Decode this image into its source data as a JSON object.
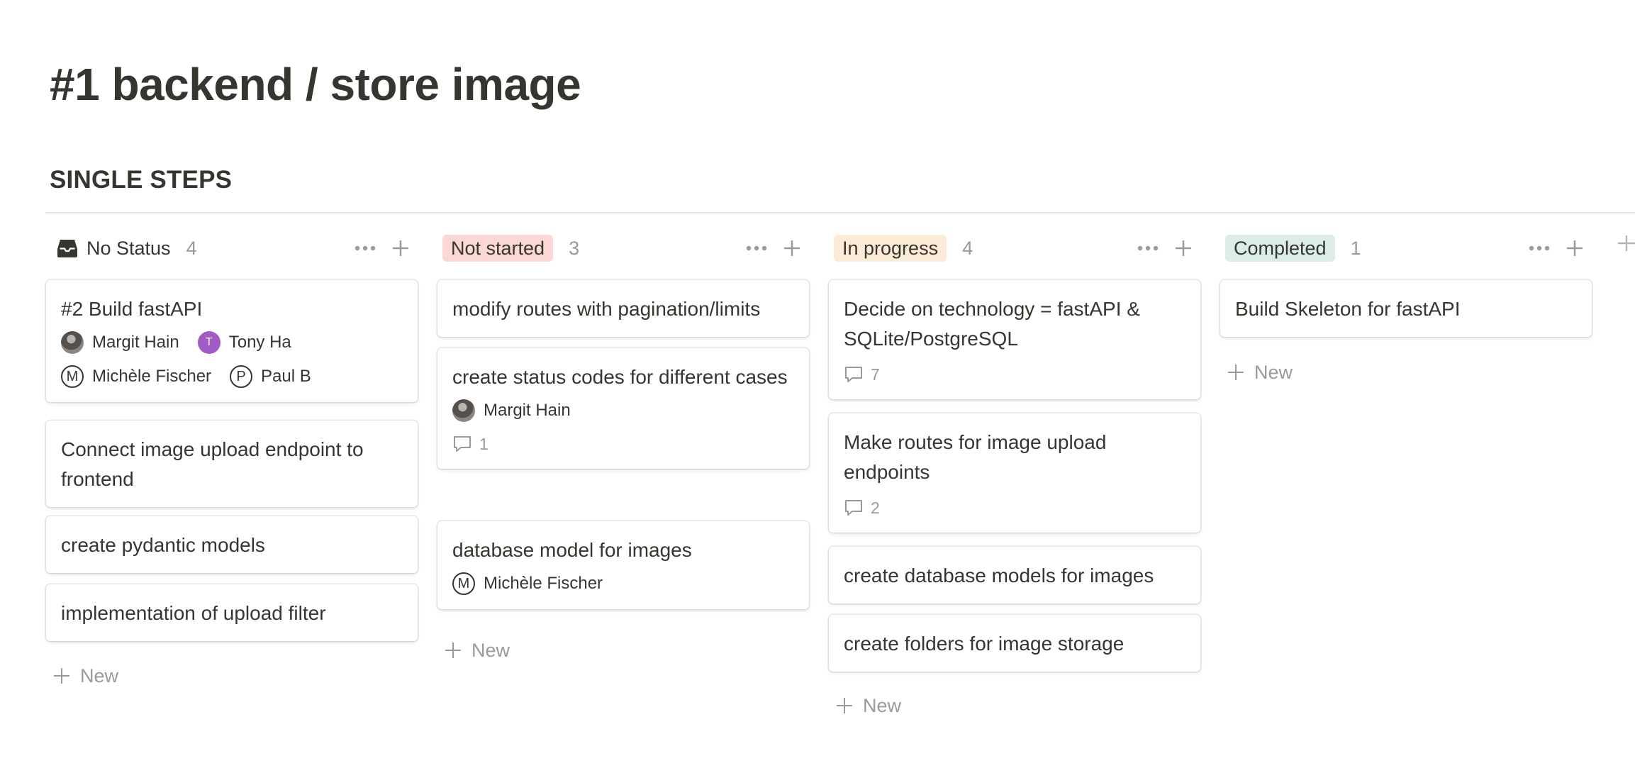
{
  "page": {
    "title": "#1 backend / store image",
    "section": "SINGLE STEPS"
  },
  "columns": [
    {
      "title": "No Status",
      "count": "4",
      "tag_color": "",
      "cards": [
        {
          "title": "#2 Build fastAPI",
          "people": [
            {
              "name": "Margit Hain",
              "avatar": "photo"
            },
            {
              "name": "Tony Ha",
              "avatar": "T"
            },
            {
              "name": "Michèle Fischer",
              "avatar": "M"
            },
            {
              "name": "Paul B",
              "avatar": "P"
            }
          ]
        },
        {
          "title": "Connect image upload endpoint to frontend"
        },
        {
          "title": "create pydantic models"
        },
        {
          "title": "implementation of upload filter"
        }
      ],
      "new_label": "New"
    },
    {
      "title": "Not started",
      "count": "3",
      "tag_color": "#fbd7d5",
      "cards": [
        {
          "title": "modify routes with pagination/limits"
        },
        {
          "title": "create status codes for different cases",
          "people": [
            {
              "name": "Margit Hain",
              "avatar": "photo"
            }
          ],
          "comments": "1"
        },
        {
          "title": "database model for images",
          "people": [
            {
              "name": "Michèle Fischer",
              "avatar": "M"
            }
          ]
        }
      ],
      "new_label": "New"
    },
    {
      "title": "In progress",
      "count": "4",
      "tag_color": "#fcecd7",
      "cards": [
        {
          "title": "Decide on technology = fastAPI & SQLite/PostgreSQL",
          "comments": "7"
        },
        {
          "title": "Make routes for image upload endpoints",
          "comments": "2"
        },
        {
          "title": "create database models for images"
        },
        {
          "title": "create folders for image storage"
        }
      ],
      "new_label": "New"
    },
    {
      "title": "Completed",
      "count": "1",
      "tag_color": "#dbede6",
      "cards": [
        {
          "title": "Build Skeleton for fastAPI"
        }
      ],
      "new_label": "New"
    }
  ],
  "icons": {
    "inbox": "inbox-icon",
    "more": "more-icon",
    "add": "plus-icon",
    "comment": "comment-icon"
  }
}
